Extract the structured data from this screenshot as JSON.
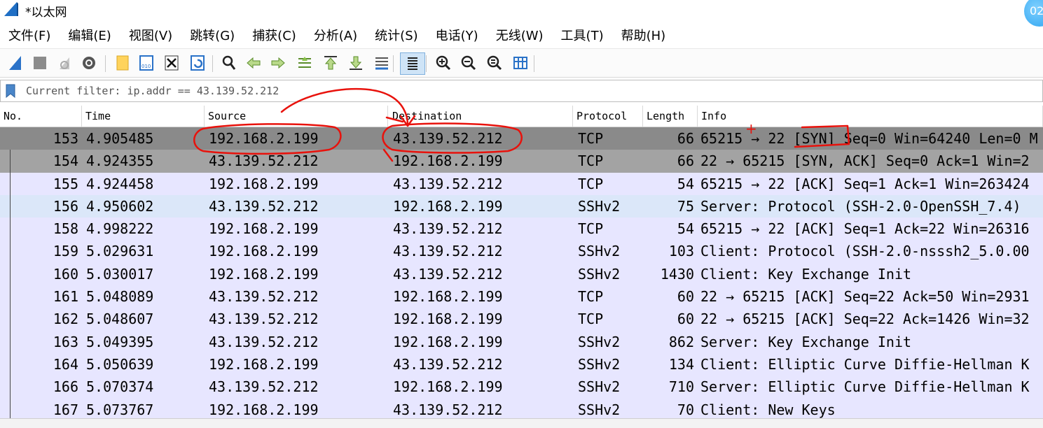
{
  "window": {
    "title": "*以太网",
    "corner_badge": "02"
  },
  "menu": [
    "文件(F)",
    "编辑(E)",
    "视图(V)",
    "跳转(G)",
    "捕获(C)",
    "分析(A)",
    "统计(S)",
    "电话(Y)",
    "无线(W)",
    "工具(T)",
    "帮助(H)"
  ],
  "toolbar": {
    "icons": [
      "start-capture-icon",
      "stop-capture-icon",
      "restart-capture-icon",
      "capture-options-icon",
      "open-file-icon",
      "save-file-icon",
      "close-file-icon",
      "reload-file-icon",
      "find-packet-icon",
      "go-back-icon",
      "go-forward-icon",
      "go-to-packet-icon",
      "first-packet-icon",
      "last-packet-icon",
      "autoscroll-icon",
      "colorize-icon",
      "zoom-in-icon",
      "zoom-out-icon",
      "normal-size-icon",
      "resize-columns-icon"
    ]
  },
  "filter": {
    "text": "Current filter: ip.addr == 43.139.52.212"
  },
  "columns": [
    "No.",
    "Time",
    "Source",
    "Destination",
    "Protocol",
    "Length",
    "Info"
  ],
  "packets": [
    {
      "no": "153",
      "time": "4.905485",
      "src": "192.168.2.199",
      "dst": "43.139.52.212",
      "proto": "TCP",
      "len": "66",
      "info": "65215 → 22 [SYN] Seq=0 Win=64240 Len=0 M",
      "style": "selected"
    },
    {
      "no": "154",
      "time": "4.924355",
      "src": "43.139.52.212",
      "dst": "192.168.2.199",
      "proto": "TCP",
      "len": "66",
      "info": "22 → 65215 [SYN, ACK] Seq=0 Ack=1 Win=2",
      "style": "related"
    },
    {
      "no": "155",
      "time": "4.924458",
      "src": "192.168.2.199",
      "dst": "43.139.52.212",
      "proto": "TCP",
      "len": "54",
      "info": "65215 → 22 [ACK] Seq=1 Ack=1 Win=263424",
      "style": "tcp"
    },
    {
      "no": "156",
      "time": "4.950602",
      "src": "43.139.52.212",
      "dst": "192.168.2.199",
      "proto": "SSHv2",
      "len": "75",
      "info": "Server: Protocol (SSH-2.0-OpenSSH_7.4)",
      "style": "ssh"
    },
    {
      "no": "158",
      "time": "4.998222",
      "src": "192.168.2.199",
      "dst": "43.139.52.212",
      "proto": "TCP",
      "len": "54",
      "info": "65215 → 22 [ACK] Seq=1 Ack=22 Win=26316",
      "style": "tcp"
    },
    {
      "no": "159",
      "time": "5.029631",
      "src": "192.168.2.199",
      "dst": "43.139.52.212",
      "proto": "SSHv2",
      "len": "103",
      "info": "Client: Protocol (SSH-2.0-nsssh2_5.0.00",
      "style": "tcp"
    },
    {
      "no": "160",
      "time": "5.030017",
      "src": "192.168.2.199",
      "dst": "43.139.52.212",
      "proto": "SSHv2",
      "len": "1430",
      "info": "Client: Key Exchange Init",
      "style": "tcp"
    },
    {
      "no": "161",
      "time": "5.048089",
      "src": "43.139.52.212",
      "dst": "192.168.2.199",
      "proto": "TCP",
      "len": "60",
      "info": "22 → 65215 [ACK] Seq=22 Ack=50 Win=2931",
      "style": "tcp"
    },
    {
      "no": "162",
      "time": "5.048607",
      "src": "43.139.52.212",
      "dst": "192.168.2.199",
      "proto": "TCP",
      "len": "60",
      "info": "22 → 65215 [ACK] Seq=22 Ack=1426 Win=32",
      "style": "tcp"
    },
    {
      "no": "163",
      "time": "5.049395",
      "src": "43.139.52.212",
      "dst": "192.168.2.199",
      "proto": "SSHv2",
      "len": "862",
      "info": "Server: Key Exchange Init",
      "style": "tcp"
    },
    {
      "no": "164",
      "time": "5.050639",
      "src": "192.168.2.199",
      "dst": "43.139.52.212",
      "proto": "SSHv2",
      "len": "134",
      "info": "Client: Elliptic Curve Diffie-Hellman K",
      "style": "tcp"
    },
    {
      "no": "166",
      "time": "5.070374",
      "src": "43.139.52.212",
      "dst": "192.168.2.199",
      "proto": "SSHv2",
      "len": "710",
      "info": "Server: Elliptic Curve Diffie-Hellman K",
      "style": "tcp"
    },
    {
      "no": "167",
      "time": "5.073767",
      "src": "192.168.2.199",
      "dst": "43.139.52.212",
      "proto": "SSHv2",
      "len": "70",
      "info": "Client: New Keys",
      "style": "tcp"
    }
  ],
  "row_colors": {
    "selected": "#8a8a8a",
    "related": "#a3a3a3",
    "tcp": "#e7e6ff",
    "ssh": "#dbe7f9"
  },
  "annotation_color": "#e8120c",
  "annotation_plus": "+"
}
